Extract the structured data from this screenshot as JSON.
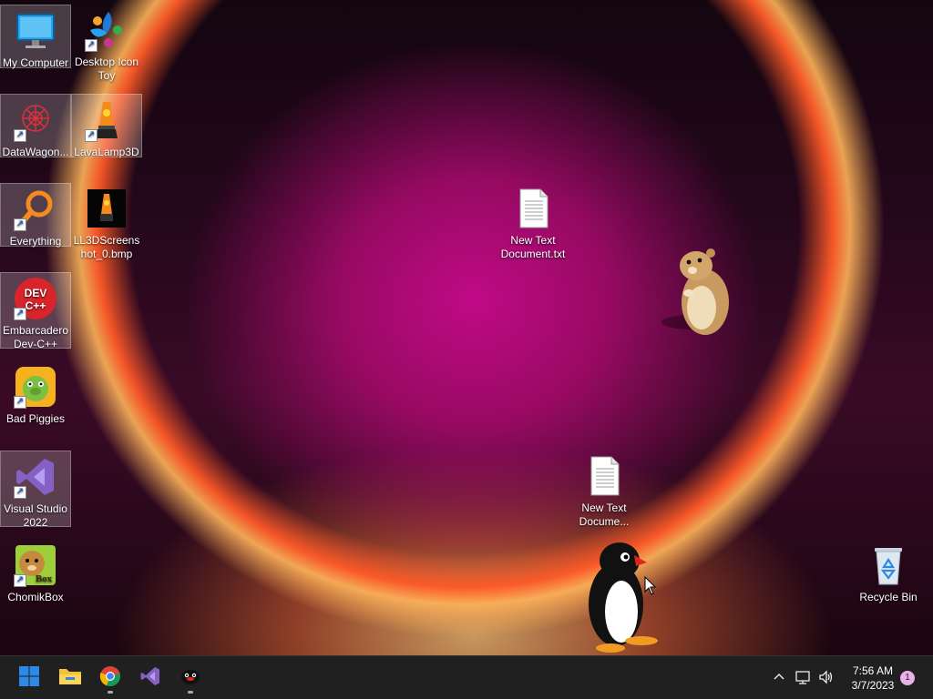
{
  "desktop_icons": {
    "my_computer": "My Computer",
    "desktop_icon_toy": "Desktop Icon Toy",
    "datawagon": "DataWagon...",
    "lavalamp3d": "LavaLamp3D",
    "everything": "Everything",
    "ll3d_screenshot": "LL3DScreenshot_0.bmp",
    "embarcadero": "Embarcadero Dev-C++",
    "bad_piggies": "Bad Piggies",
    "visual_studio": "Visual Studio 2022",
    "chomikbox": "ChomikBox",
    "new_text_1": "New Text Document.txt",
    "new_text_2": "New Text Docume...",
    "recycle_bin": "Recycle Bin"
  },
  "icon_glyph_text": {
    "devcpp": "DEV C++",
    "chomik_box": "Box"
  },
  "taskbar": {
    "clock_time": "7:56 AM",
    "clock_date": "3/7/2023",
    "notification_count": "1"
  },
  "colors": {
    "taskbar_bg": "#202020",
    "accent_blue": "#2b8ae6"
  }
}
